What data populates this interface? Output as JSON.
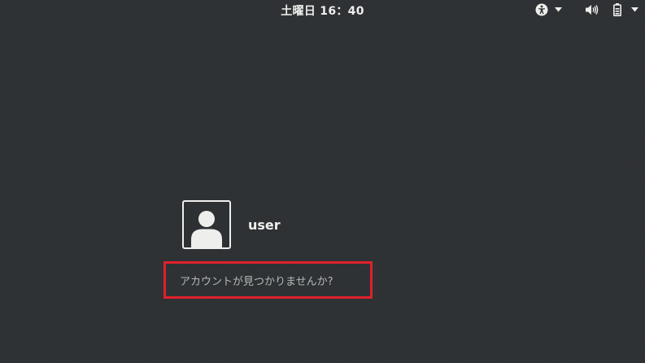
{
  "topbar": {
    "clock": "土曜日 16：40",
    "icons": {
      "accessibility": "accessibility-icon",
      "volume": "volume-icon",
      "battery": "battery-icon",
      "menu": "chevron-down-icon"
    }
  },
  "login": {
    "users": [
      {
        "name": "user",
        "avatar": "user-avatar-icon"
      }
    ],
    "not_listed_label": "アカウントが見つかりませんか?"
  },
  "colors": {
    "background": "#2e3134",
    "text": "#eeeeec",
    "muted_text": "#b6b9b6",
    "highlight_border": "#e0202a"
  }
}
